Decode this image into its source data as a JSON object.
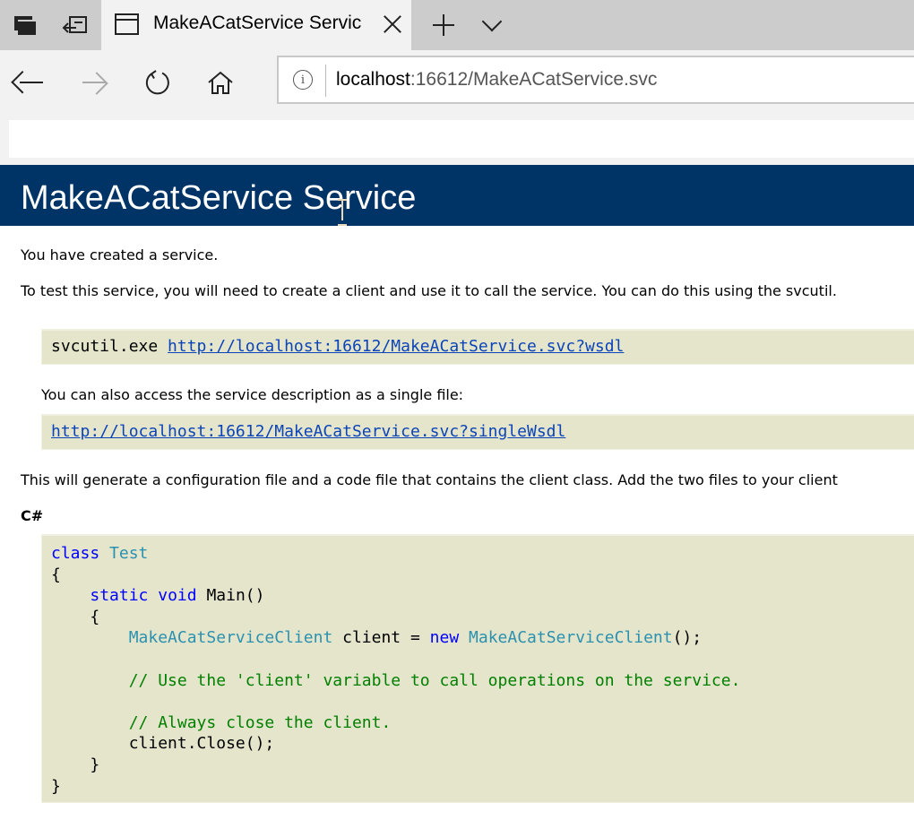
{
  "browser": {
    "tab": {
      "title": "MakeACatService Servic"
    },
    "address": {
      "host": "localhost",
      "rest": ":16612/MakeACatService.svc"
    },
    "icons": {
      "tab_preview": "tab-preview-icon",
      "set_aside": "set-aside-icon",
      "favicon": "page-favicon-icon",
      "close": "close-icon",
      "new_tab": "plus-icon",
      "tab_list": "chevron-down-icon",
      "back": "back-arrow-icon",
      "forward": "forward-arrow-icon",
      "refresh": "refresh-icon",
      "home": "home-icon",
      "info": "info-icon"
    }
  },
  "page": {
    "title": "MakeACatService Service",
    "intro": "You have created a service.",
    "test_text": "To test this service, you will need to create a client and use it to call the service. You can do this using the svcutil.",
    "svcutil_cmd": "svcutil.exe ",
    "wsdl_link": "http://localhost:16612/MakeACatService.svc?wsdl",
    "single_file_text": "You can also access the service description as a single file:",
    "single_wsdl_link": "http://localhost:16612/MakeACatService.svc?singleWsdl",
    "generate_text": "This will generate a configuration file and a code file that contains the client class. Add the two files to your client",
    "csharp_heading": "C#",
    "code": {
      "l1_kw": "class",
      "l1_type": "Test",
      "brace_open": "{",
      "brace_close": "}",
      "l3_static": "static",
      "l3_void": "void",
      "l3_main": "Main()",
      "l5_type": "MakeACatServiceClient",
      "l5_var": " client = ",
      "l5_new": "new",
      "l5_type2": "MakeACatServiceClient",
      "l5_end": "();",
      "comment1": "// Use the 'client' variable to call operations on the service.",
      "comment2": "// Always close the client.",
      "close_call": "client.Close();"
    }
  }
}
